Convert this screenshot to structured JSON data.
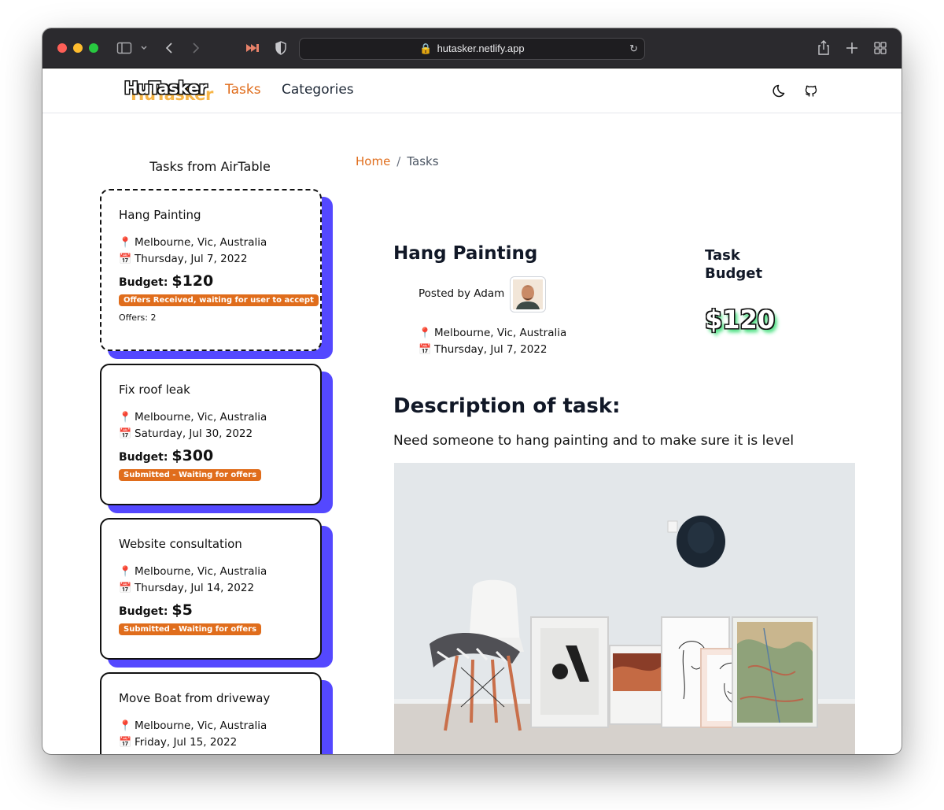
{
  "browser": {
    "url": "hutasker.netlify.app"
  },
  "nav": {
    "logo": "HuTasker",
    "links": [
      "Tasks",
      "Categories"
    ]
  },
  "sidebar": {
    "title": "Tasks from AirTable",
    "budget_label": "Budget:",
    "tasks": [
      {
        "title": "Hang Painting",
        "location": "Melbourne, Vic, Australia",
        "date": "Thursday, Jul 7, 2022",
        "budget": "$120",
        "status": "Offers Received, waiting for user to accept",
        "offers": "Offers: 2"
      },
      {
        "title": "Fix roof leak",
        "location": "Melbourne, Vic, Australia",
        "date": "Saturday, Jul 30, 2022",
        "budget": "$300",
        "status": "Submitted - Waiting for offers"
      },
      {
        "title": "Website consultation",
        "location": "Melbourne, Vic, Australia",
        "date": "Thursday, Jul 14, 2022",
        "budget": "$5",
        "status": "Submitted - Waiting for offers"
      },
      {
        "title": "Move Boat from driveway",
        "location": "Melbourne, Vic, Australia",
        "date": "Friday, Jul 15, 2022"
      }
    ]
  },
  "breadcrumb": {
    "home": "Home",
    "separator": "/",
    "current": "Tasks"
  },
  "detail": {
    "title": "Hang Painting",
    "posted_by": "Posted by Adam",
    "location": "Melbourne, Vic, Australia",
    "date": "Thursday, Jul 7, 2022",
    "budget_heading_1": "Task",
    "budget_heading_2": "Budget",
    "budget": "$120",
    "description_heading": "Description of task:",
    "description": "Need someone to hang painting and to make sure it is level"
  },
  "colors": {
    "accent": "#e06d1c",
    "card_shadow": "#5448ff",
    "budget_glow": "#4ade80"
  },
  "icons": [
    "sidebar-icon",
    "chevron-left-icon",
    "chevron-right-icon",
    "share-icon",
    "plus-icon",
    "tabs-grid-icon",
    "moon-icon",
    "github-icon",
    "pin-icon",
    "calendar-icon"
  ]
}
